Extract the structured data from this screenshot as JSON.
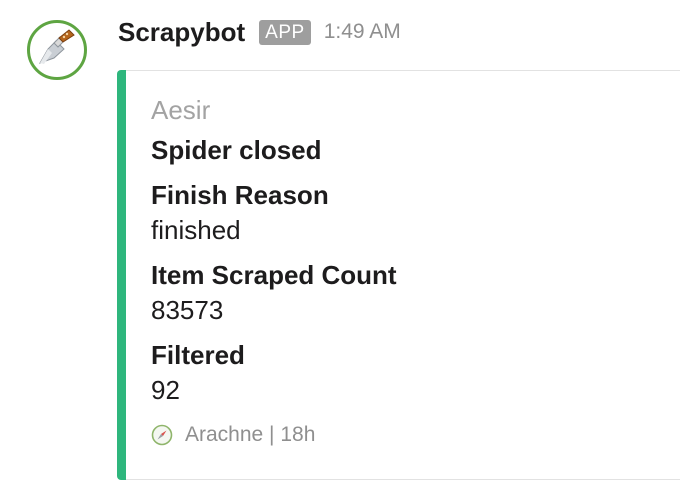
{
  "message": {
    "bot_name": "Scrapybot",
    "badge": "APP",
    "time": "1:49 AM",
    "avatar_icon": "putty-knife-icon",
    "accent_color": "#2eb67d"
  },
  "attachment": {
    "author": "Aesir",
    "title": "Spider closed",
    "fields": [
      {
        "title": "Finish Reason",
        "value": "finished"
      },
      {
        "title": "Item Scraped Count",
        "value": "83573"
      },
      {
        "title": "Filtered",
        "value": "92"
      }
    ],
    "footer": {
      "icon": "compass-icon",
      "text": "Arachne | 18h"
    }
  }
}
